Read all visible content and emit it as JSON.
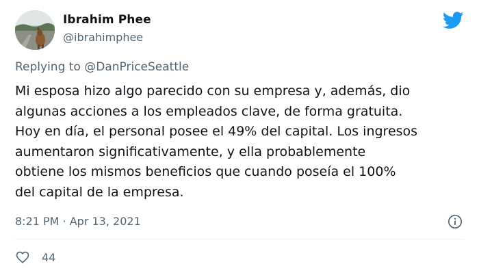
{
  "author": {
    "name": "Ibrahim Phee",
    "handle": "@ibrahimphee"
  },
  "icons": {
    "brand": "twitter-bird-icon",
    "info": "info-icon",
    "like": "heart-icon"
  },
  "colors": {
    "brand": "#1d9bf0",
    "secondary_text": "#536471",
    "primary_text": "#0f1419"
  },
  "reply": {
    "prefix": "Replying to",
    "mention": "@DanPriceSeattle"
  },
  "body_lines": [
    "Mi esposa hizo algo parecido con su empresa y, además, dio",
    "algunas acciones a los empleados clave, de forma gratuita.",
    "Hoy en día, el personal posee el 49% del capital. Los ingresos",
    "aumentaron significativamente, y ella probablemente",
    "obtiene los mismos beneficios que cuando poseía el 100%",
    "del capital de la empresa."
  ],
  "timestamp": "8:21 PM · Apr 13, 2021",
  "likes": "44"
}
